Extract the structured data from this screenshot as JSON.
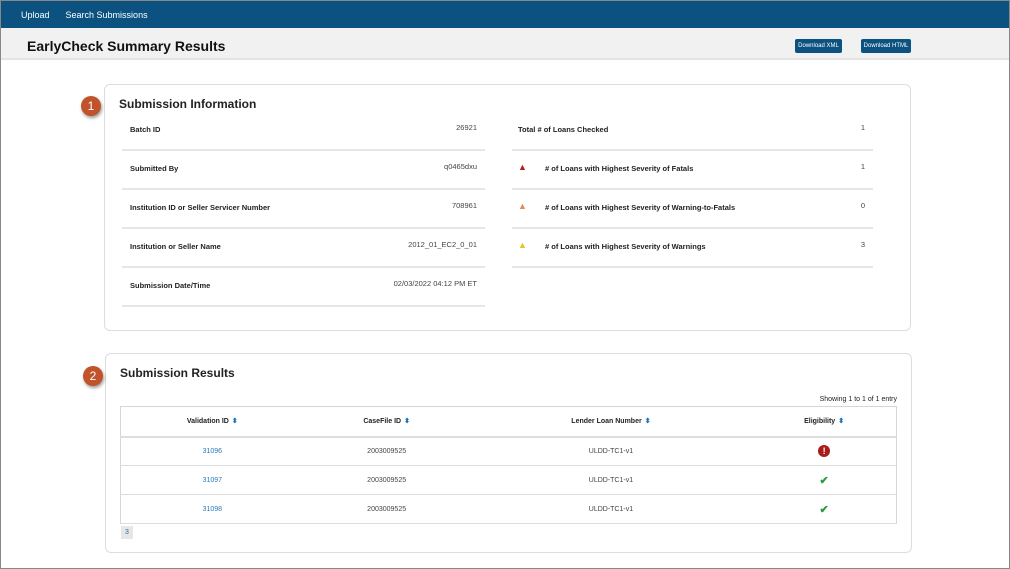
{
  "nav": {
    "items": [
      "Upload",
      "Search Submissions"
    ]
  },
  "header": {
    "title": "EarlyCheck Summary Results",
    "download_xml": "Download XML",
    "download_html": "Download HTML"
  },
  "submission_info": {
    "badge": "1",
    "title": "Submission Information",
    "left": [
      {
        "label": "Batch ID",
        "value": "26921"
      },
      {
        "label": "Submitted By",
        "value": "q0465dxu"
      },
      {
        "label": "Institution ID or Seller Servicer Number",
        "value": "708961"
      },
      {
        "label": "Institution or Seller Name",
        "value": "2012_01_EC2_0_01"
      },
      {
        "label": "Submission Date/Time",
        "value": "02/03/2022 04:12 PM ET"
      }
    ],
    "right": [
      {
        "label": "Total # of Loans Checked",
        "value": "1",
        "icon": ""
      },
      {
        "label": "# of Loans with Highest Severity of Fatals",
        "value": "1",
        "icon": "fatal-warning-icon",
        "color": "#b41f1f"
      },
      {
        "label": "# of Loans with Highest Severity of Warning-to-Fatals",
        "value": "0",
        "icon": "warning-to-fatal-icon",
        "color": "#e8874f"
      },
      {
        "label": "# of Loans with Highest Severity of Warnings",
        "value": "3",
        "icon": "warning-icon",
        "color": "#e3c520"
      }
    ]
  },
  "submission_results": {
    "badge": "2",
    "title": "Submission Results",
    "showing": "Showing 1 to 1 of 1 entry",
    "columns": [
      "Validation ID",
      "CaseFile ID",
      "Lender Loan Number",
      "Eligibility"
    ],
    "rows": [
      {
        "validation_id": "31096",
        "casefile_id": "2003009525",
        "lender_loan": "ULDD-TC1-v1",
        "eligibility": "fatal"
      },
      {
        "validation_id": "31097",
        "casefile_id": "2003009525",
        "lender_loan": "ULDD-TC1-v1",
        "eligibility": "eligible"
      },
      {
        "validation_id": "31098",
        "casefile_id": "2003009525",
        "lender_loan": "ULDD-TC1-v1",
        "eligibility": "eligible"
      }
    ],
    "page": "3"
  }
}
